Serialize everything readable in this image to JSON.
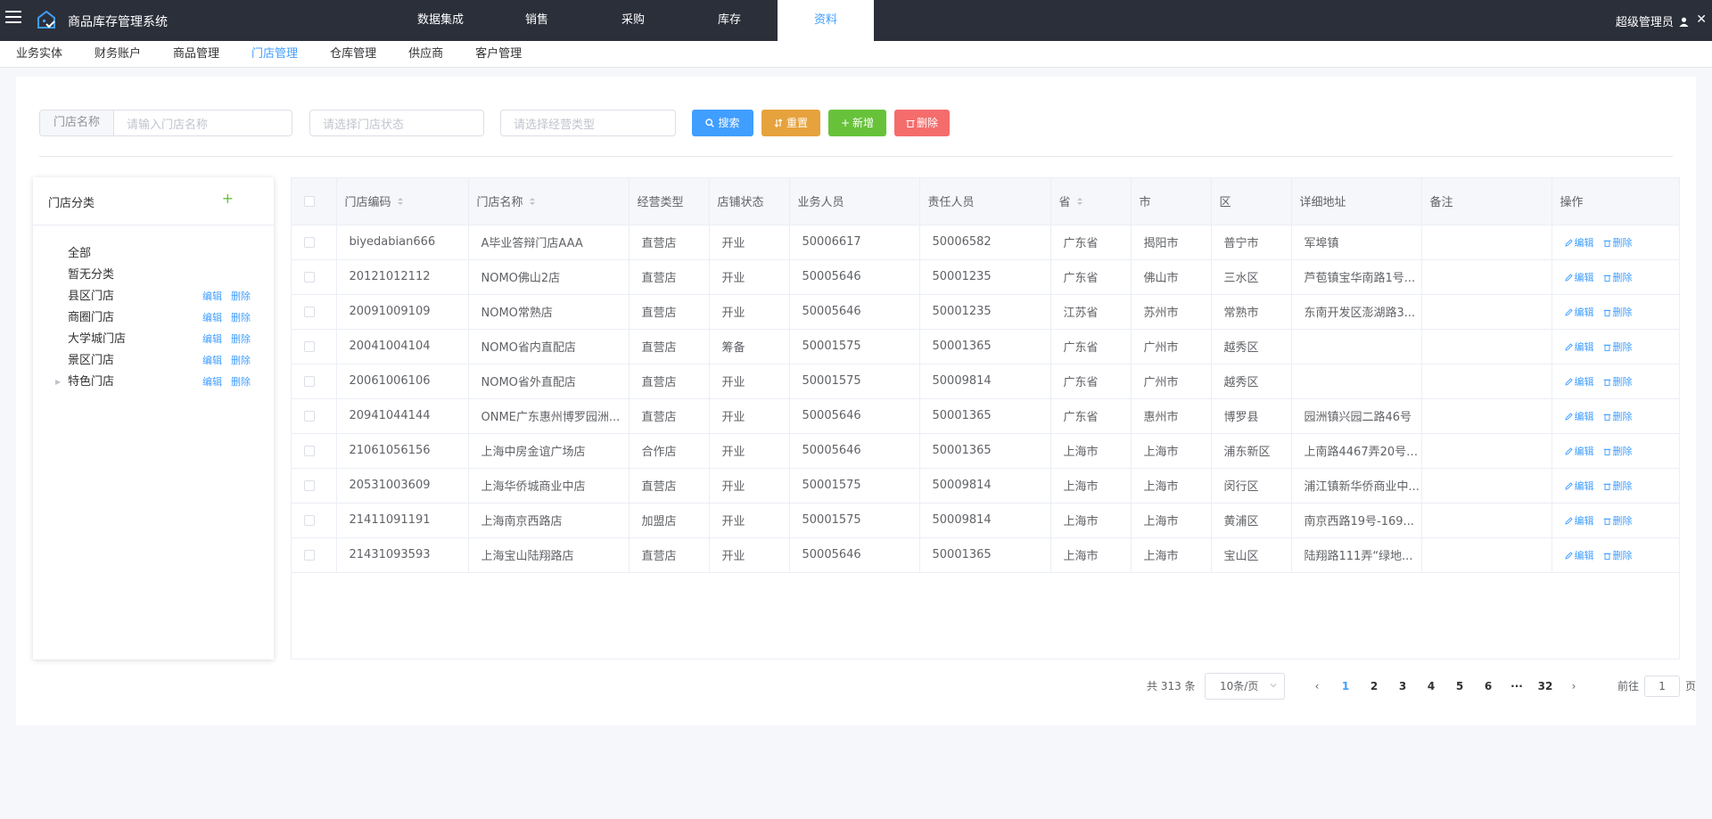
{
  "app": {
    "title": "商品库存管理系统",
    "user": "超级管理员"
  },
  "top_tabs": [
    {
      "label": "数据集成",
      "active": false
    },
    {
      "label": "销售",
      "active": false
    },
    {
      "label": "采购",
      "active": false
    },
    {
      "label": "库存",
      "active": false
    },
    {
      "label": "资料",
      "active": true
    }
  ],
  "sub_nav": [
    {
      "label": "业务实体",
      "active": false
    },
    {
      "label": "财务账户",
      "active": false
    },
    {
      "label": "商品管理",
      "active": false
    },
    {
      "label": "门店管理",
      "active": true
    },
    {
      "label": "仓库管理",
      "active": false
    },
    {
      "label": "供应商",
      "active": false
    },
    {
      "label": "客户管理",
      "active": false
    }
  ],
  "filters": {
    "store_name_label": "门店名称",
    "store_name_placeholder": "请输入门店名称",
    "store_status_placeholder": "请选择门店状态",
    "business_type_placeholder": "请选择经营类型"
  },
  "buttons": {
    "search": "搜索",
    "reset": "重置",
    "add": "新增",
    "delete": "删除"
  },
  "tree": {
    "title": "门店分类",
    "edit_label": "编辑",
    "delete_label": "删除",
    "nodes": [
      {
        "label": "全部",
        "actions": false,
        "expandable": false
      },
      {
        "label": "暂无分类",
        "actions": false,
        "expandable": false
      },
      {
        "label": "县区门店",
        "actions": true,
        "expandable": false
      },
      {
        "label": "商圈门店",
        "actions": true,
        "expandable": false
      },
      {
        "label": "大学城门店",
        "actions": true,
        "expandable": false
      },
      {
        "label": "景区门店",
        "actions": true,
        "expandable": false
      },
      {
        "label": "特色门店",
        "actions": true,
        "expandable": true
      }
    ]
  },
  "table": {
    "columns": [
      "门店编码",
      "门店名称",
      "经营类型",
      "店铺状态",
      "业务人员",
      "责任人员",
      "省",
      "市",
      "区",
      "详细地址",
      "备注",
      "操作"
    ],
    "sortable_columns": [
      "门店编码",
      "门店名称",
      "省"
    ],
    "edit_label": "编辑",
    "delete_label": "删除",
    "rows": [
      [
        "biyedabian666",
        "A毕业答辩门店AAA",
        "直营店",
        "开业",
        "50006617",
        "50006582",
        "广东省",
        "揭阳市",
        "普宁市",
        "军埠镇",
        ""
      ],
      [
        "20121012112",
        "NOMO佛山2店",
        "直营店",
        "开业",
        "50005646",
        "50001235",
        "广东省",
        "佛山市",
        "三水区",
        "芦苞镇宝华南路1号...",
        ""
      ],
      [
        "20091009109",
        "NOMO常熟店",
        "直营店",
        "开业",
        "50005646",
        "50001235",
        "江苏省",
        "苏州市",
        "常熟市",
        "东南开发区澎湖路3...",
        ""
      ],
      [
        "20041004104",
        "NOMO省内直配店",
        "直营店",
        "筹备",
        "50001575",
        "50001365",
        "广东省",
        "广州市",
        "越秀区",
        "",
        ""
      ],
      [
        "20061006106",
        "NOMO省外直配店",
        "直营店",
        "开业",
        "50001575",
        "50009814",
        "广东省",
        "广州市",
        "越秀区",
        "",
        ""
      ],
      [
        "20941044144",
        "ONME广东惠州博罗园洲...",
        "直营店",
        "开业",
        "50005646",
        "50001365",
        "广东省",
        "惠州市",
        "博罗县",
        "园洲镇兴园二路46号",
        ""
      ],
      [
        "21061056156",
        "上海中房金谊广场店",
        "合作店",
        "开业",
        "50005646",
        "50001365",
        "上海市",
        "上海市",
        "浦东新区",
        "上南路4467弄20号2...",
        ""
      ],
      [
        "20531003609",
        "上海华侨城商业中店",
        "直营店",
        "开业",
        "50001575",
        "50009814",
        "上海市",
        "上海市",
        "闵行区",
        "浦江镇新华侨商业中...",
        ""
      ],
      [
        "21411091191",
        "上海南京西路店",
        "加盟店",
        "开业",
        "50001575",
        "50009814",
        "上海市",
        "上海市",
        "黄浦区",
        "南京西路19号-169...",
        ""
      ],
      [
        "21431093593",
        "上海宝山陆翔路店",
        "直营店",
        "开业",
        "50005646",
        "50001365",
        "上海市",
        "上海市",
        "宝山区",
        "陆翔路111弄“绿地...",
        ""
      ]
    ]
  },
  "pagination": {
    "total_text": "共 313 条",
    "page_size": "10条/页",
    "pages": [
      "1",
      "2",
      "3",
      "4",
      "5",
      "6",
      "···",
      "32"
    ],
    "current": "1",
    "goto_prefix": "前往",
    "goto_value": "1",
    "goto_suffix": "页"
  },
  "colors": {
    "primary": "#409eff",
    "warning": "#e6a23c",
    "success": "#67c23a",
    "danger": "#f56c6c",
    "topbar": "#2b2f3a"
  }
}
